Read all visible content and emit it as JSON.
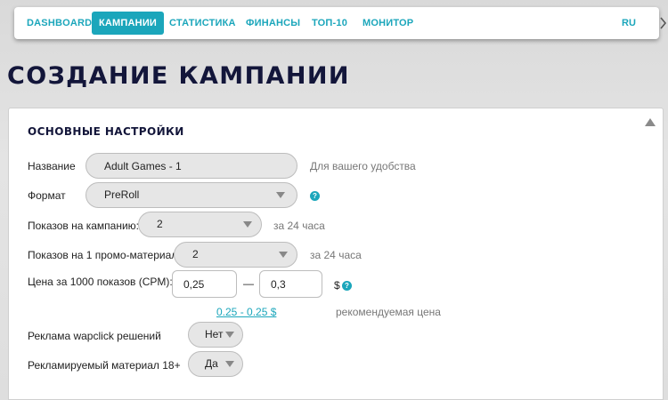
{
  "nav": {
    "items": [
      {
        "label": "DASHBOARD",
        "active": false
      },
      {
        "label": "КАМПАНИИ",
        "active": true
      },
      {
        "label": "СТАТИСТИКА",
        "active": false
      },
      {
        "label": "ФИНАНСЫ",
        "active": false
      },
      {
        "label": "ТОП-10",
        "active": false
      },
      {
        "label": "МОНИТОР",
        "active": false
      }
    ],
    "lang": "RU"
  },
  "page": {
    "title": "СОЗДАНИЕ КАМПАНИИ"
  },
  "panel": {
    "title": "ОСНОВНЫЕ НАСТРОЙКИ"
  },
  "form": {
    "name": {
      "label": "Название",
      "value": "Adult Games - 1",
      "hint": "Для вашего удобства"
    },
    "format": {
      "label": "Формат",
      "value": "PreRoll",
      "help_icon": "question-icon"
    },
    "impressions_campaign": {
      "label": "Показов на кампанию:",
      "value": "2",
      "hint": "за 24 часа"
    },
    "impressions_promo": {
      "label": "Показов на 1 промо-материал:",
      "value": "2",
      "hint": "за 24 часа"
    },
    "cpm": {
      "label": "Цена за 1000 показов (CPM):",
      "min": "0,25",
      "separator": "—",
      "max": "0,3",
      "currency": "$",
      "recommended_link": "0.25 - 0.25 $",
      "recommended_label": "рекомендуемая цена"
    },
    "wapclick": {
      "label": "Реклама wapclick решений",
      "value": "Нет"
    },
    "adult": {
      "label": "Рекламируемый материал 18+",
      "value": "Да"
    }
  },
  "colors": {
    "accent": "#1ba6bb",
    "title": "#13163a"
  }
}
